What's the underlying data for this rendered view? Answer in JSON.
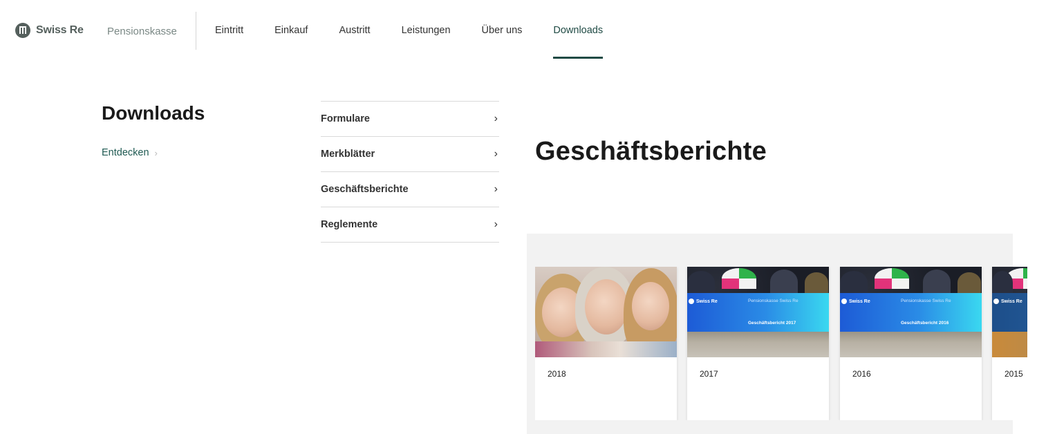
{
  "brand": {
    "logo_text": "Swiss Re",
    "subtitle": "Pensionskasse"
  },
  "nav": {
    "items": [
      {
        "label": "Eintritt"
      },
      {
        "label": "Einkauf"
      },
      {
        "label": "Austritt"
      },
      {
        "label": "Leistungen"
      },
      {
        "label": "Über uns"
      },
      {
        "label": "Downloads",
        "active": true
      }
    ]
  },
  "section": {
    "title": "Downloads",
    "explore_label": "Entdecken"
  },
  "submenu": {
    "items": [
      {
        "label": "Formulare"
      },
      {
        "label": "Merkblätter"
      },
      {
        "label": "Geschäftsberichte"
      },
      {
        "label": "Reglemente"
      }
    ]
  },
  "main": {
    "heading": "Geschäftsberichte"
  },
  "cards": [
    {
      "year": "2018",
      "image": "family-photo"
    },
    {
      "year": "2017",
      "image": "report-cover",
      "cover_logo": "Swiss Re",
      "cover_org": "Pensionskasse Swiss Re",
      "cover_title": "Geschäftsbericht 2017"
    },
    {
      "year": "2016",
      "image": "report-cover",
      "cover_logo": "Swiss Re",
      "cover_org": "Pensionskasse Swiss Re",
      "cover_title": "Geschäftsbericht 2016"
    },
    {
      "year": "2015",
      "image": "report-cover",
      "cover_logo": "Swiss Re"
    }
  ],
  "colors": {
    "brand_green": "#1f4a44",
    "logo_grey": "#55605d",
    "link_green": "#1f5a52",
    "carousel_bg": "#f2f2f2"
  },
  "icons": {
    "logo": "swiss-re-logo-icon",
    "chevron": "chevron-right-icon"
  }
}
